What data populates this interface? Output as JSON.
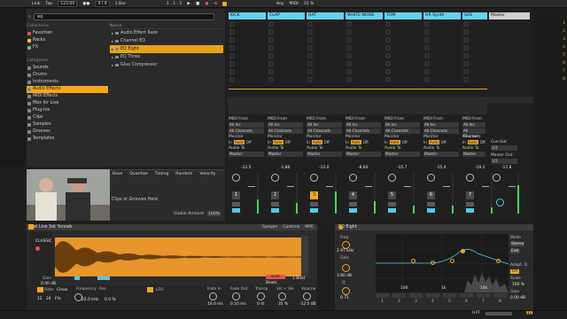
{
  "transport": {
    "link": "Link",
    "tap": "Tap",
    "tempo": "123.00",
    "sig": "4 / 4",
    "quant": "1 Bar",
    "key": "Key",
    "midi": "MIDI",
    "cpu": "15 %"
  },
  "browser": {
    "search_value": "eq",
    "collections_header": "Collections",
    "collections": [
      "Favoriten",
      "Racks",
      "FX"
    ],
    "categories_header": "Categories",
    "categories": [
      "Sounds",
      "Drums",
      "Instruments",
      "Audio Effects",
      "MIDI Effects",
      "Max for Live",
      "Plug-Ins",
      "Clips",
      "Samples",
      "Grooves",
      "Templates"
    ],
    "name_header": "Name",
    "files": [
      "Audio Effect Rack",
      "Channel EQ",
      "EQ Eight",
      "EQ Three",
      "Glue Compressor"
    ]
  },
  "groove": {
    "cols": [
      "Base",
      "Quantize",
      "Timing",
      "Random",
      "Velocity"
    ],
    "hint": "Clips or Grooves Here",
    "global_label": "Global Amount",
    "global_value": "100%"
  },
  "session": {
    "tracks": [
      "KICK",
      "CLAP",
      "HAT",
      "WHITE NOISE",
      "TOM",
      "HR Synth",
      "SUS",
      "Master"
    ],
    "scene_nums": [
      "1",
      "2",
      "3",
      "4",
      "5",
      "6",
      "7",
      "8"
    ],
    "midi_from": "MIDI From",
    "all_ins": "All Ins",
    "all_channels": "All Channels",
    "monitor": "Monitor",
    "in": "In",
    "auto": "Auto",
    "off": "Off",
    "audio_to": "Audio To",
    "master": "Master",
    "cue_out": "Cue Out",
    "cue_val": "1/2",
    "master_out": "Master Out",
    "master_val": "1/2",
    "levels": [
      "-12.5",
      "-1.86",
      "-12.0",
      "-8.60",
      "-15.7",
      "-15.4",
      "-19.2",
      "-17.8",
      "-0.59"
    ],
    "track_nums": [
      "1",
      "2",
      "3",
      "4",
      "5",
      "6",
      "7"
    ]
  },
  "clip": {
    "title": "Hat Live Set Yonnek",
    "tabs": [
      "Sample",
      "Controls",
      "MPE"
    ],
    "gain_label": "Gain",
    "gain_value": "0.00 dB",
    "filter_label": "Filter",
    "freq_label": "Frequency",
    "res_label": "Res",
    "freq_value": "22.0 kHz",
    "res_value": "0.0 %",
    "lfo_label": "LFO",
    "fadein_label": "Fade In",
    "fadeout_label": "Fade Out",
    "transp_label": "Transp",
    "vel_label": "Vol < Vel",
    "volume_label": "Volume",
    "fadein_value": "10.0 ms",
    "fadeout_value": "0.10 ms",
    "transp_value": "0 st",
    "vel_value": "35 %",
    "volume_value": "-12.0 dB",
    "clean": "Clean",
    "warp": "WARP",
    "beats": "Beats",
    "xl": "1 Beat",
    "sel": "CLASSIC",
    "kbd": [
      "12",
      "24",
      "Ffx"
    ]
  },
  "eq": {
    "title": "EQ Eight",
    "freq_label": "Freq",
    "freq_value": "2.97 kHz",
    "gain_label": "Gain",
    "gain_value": "3.60 dB",
    "q_label": "Q",
    "q_value": "0.71",
    "mode_label": "Mode",
    "mode_value": "Stereo",
    "edit_label": "Edit",
    "adapt_label": "Adapt. Q",
    "adapt_value": "On",
    "scale_label": "Scale",
    "scale_value": "100 %",
    "gain2_label": "Gain",
    "gain2_value": "0.00 dB",
    "x_ticks": [
      "100",
      "1k",
      "10k"
    ],
    "band_nums": [
      "1",
      "2",
      "3",
      "4",
      "5",
      "6",
      "7",
      "8"
    ]
  },
  "status": {
    "track": "HAT"
  },
  "colors": {
    "accent": "#f5a623",
    "track": "#63d3f0",
    "wave": "#e8962c",
    "meter": "#3fdc5a"
  }
}
